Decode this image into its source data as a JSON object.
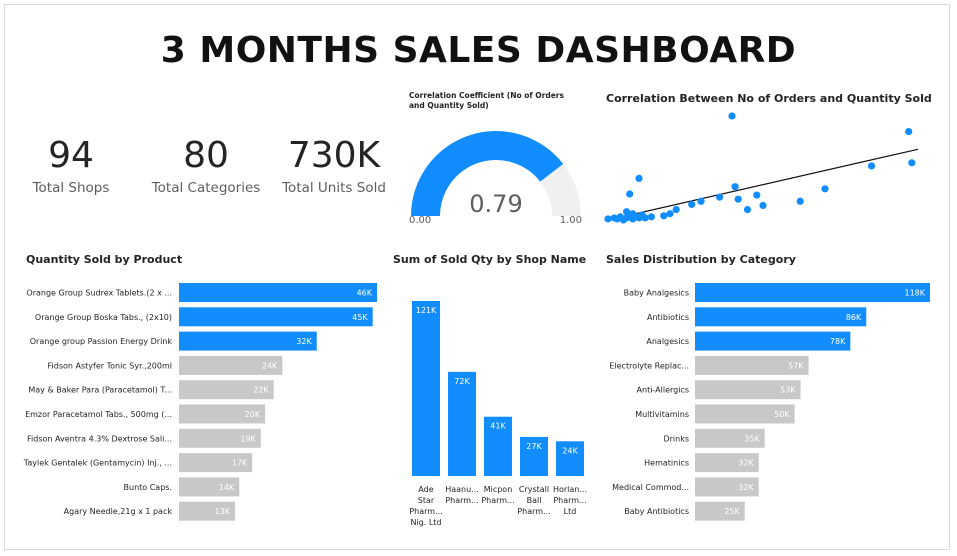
{
  "title": "3 MONTHS SALES DASHBOARD",
  "kpis": [
    {
      "value": "94",
      "label": "Total Shops"
    },
    {
      "value": "80",
      "label": "Total Categories"
    },
    {
      "value": "730K",
      "label": "Total Units Sold"
    }
  ],
  "colors": {
    "highlight": "#118dff",
    "muted": "#c8c8c8",
    "gauge_track": "#f0f0f0",
    "trend": "#111111"
  },
  "gauge": {
    "title": "Correlation Coefficient (No of Orders and Quantity Sold)",
    "value": 0.79,
    "value_label": "0.79",
    "min_label": "0.00",
    "max_label": "1.00",
    "min": 0,
    "max": 1
  },
  "chart_data": [
    {
      "id": "scatter",
      "type": "scatter",
      "title": "Correlation Between No of Orders and Quantity Sold",
      "xlabel": "",
      "ylabel": "",
      "points": [
        [
          0.0,
          0.01
        ],
        [
          0.02,
          0.02
        ],
        [
          0.03,
          0.01
        ],
        [
          0.04,
          0.03
        ],
        [
          0.05,
          0.0
        ],
        [
          0.06,
          0.02
        ],
        [
          0.07,
          0.04
        ],
        [
          0.08,
          0.01
        ],
        [
          0.09,
          0.03
        ],
        [
          0.1,
          0.02
        ],
        [
          0.11,
          0.05
        ],
        [
          0.12,
          0.02
        ],
        [
          0.08,
          0.06
        ],
        [
          0.14,
          0.03
        ],
        [
          0.06,
          0.08
        ],
        [
          0.2,
          0.06
        ],
        [
          0.18,
          0.04
        ],
        [
          0.07,
          0.25
        ],
        [
          0.1,
          0.4
        ],
        [
          0.22,
          0.1
        ],
        [
          0.27,
          0.15
        ],
        [
          0.3,
          0.18
        ],
        [
          0.36,
          0.22
        ],
        [
          0.42,
          0.2
        ],
        [
          0.45,
          0.1
        ],
        [
          0.48,
          0.24
        ],
        [
          0.5,
          0.14
        ],
        [
          0.41,
          0.32
        ],
        [
          0.62,
          0.18
        ],
        [
          0.7,
          0.3
        ],
        [
          0.85,
          0.52
        ],
        [
          0.97,
          0.85
        ],
        [
          0.98,
          0.55
        ],
        [
          0.4,
          1.0
        ]
      ],
      "trend": [
        [
          0.0,
          0.0
        ],
        [
          1.0,
          0.68
        ]
      ]
    },
    {
      "id": "qty_by_product",
      "type": "bar",
      "orientation": "horizontal",
      "title": "Quantity Sold by Product",
      "categories": [
        "Orange Group Sudrex Tablets.(2 x ...",
        "Orange Group Boska Tabs., (2x10)",
        "Orange group Passion Energy Drink",
        "Fidson Astyfer Tonic Syr.,200ml",
        "May & Baker Para (Paracetamol) T...",
        "Emzor Paracetamol Tabs., 500mg (...",
        "Fidson Aventra 4.3% Dextrose Sali...",
        "Taylek Gentalek (Gentamycin) Inj., ...",
        "Bunto Caps.",
        "Agary Needle,21g x 1 pack"
      ],
      "values": [
        46,
        45,
        32,
        24,
        22,
        20,
        19,
        17,
        14,
        13
      ],
      "labels": [
        "46K",
        "45K",
        "32K",
        "24K",
        "22K",
        "20K",
        "19K",
        "17K",
        "14K",
        "13K"
      ],
      "highlight_count": 3,
      "unit": "K"
    },
    {
      "id": "qty_by_shop",
      "type": "bar",
      "orientation": "vertical",
      "title": "Sum of Sold Qty by Shop Name",
      "categories": [
        [
          "Ade",
          "Star",
          "Pharm...",
          "Nig. Ltd"
        ],
        [
          "Haanu...",
          "Pharm..."
        ],
        [
          "Micpon",
          "Pharm..."
        ],
        [
          "Crystall",
          "Ball",
          "Pharm..."
        ],
        [
          "Horlan...",
          "Pharm...",
          "Ltd"
        ]
      ],
      "values": [
        121,
        72,
        41,
        27,
        24
      ],
      "labels": [
        "121K",
        "72K",
        "41K",
        "27K",
        "24K"
      ],
      "unit": "K"
    },
    {
      "id": "sales_by_category",
      "type": "bar",
      "orientation": "horizontal",
      "title": "Sales Distribution by Category",
      "categories": [
        "Baby Analgesics",
        "Antibiotics",
        "Analgesics",
        "Electrolyte Replac...",
        "Anti-Allergics",
        "Multivitamins",
        "Drinks",
        "Hematinics",
        "Medical Commod...",
        "Baby Antibiotics"
      ],
      "values": [
        118,
        86,
        78,
        57,
        53,
        50,
        35,
        32,
        32,
        25
      ],
      "labels": [
        "118K",
        "86K",
        "78K",
        "57K",
        "53K",
        "50K",
        "35K",
        "32K",
        "32K",
        "25K"
      ],
      "highlight_count": 3,
      "unit": "K"
    }
  ]
}
